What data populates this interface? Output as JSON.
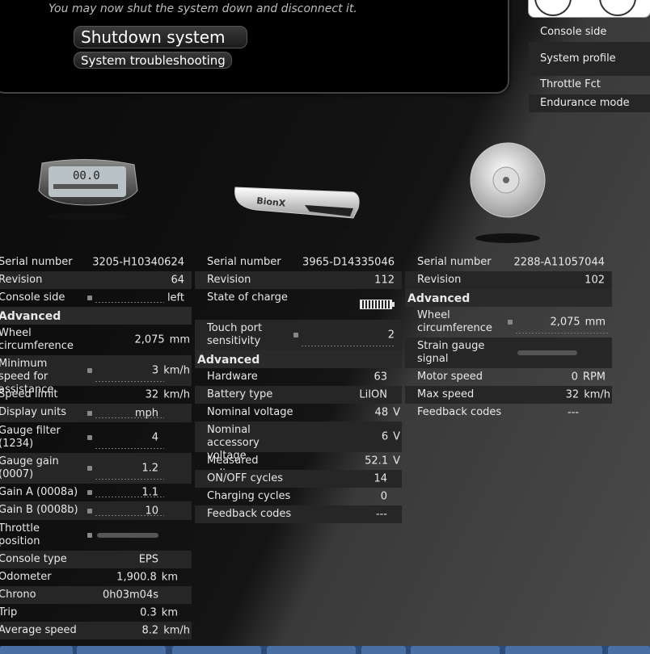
{
  "dialog": {
    "message": "You may now shut the system down and disconnect it.",
    "shutdown_label": "Shutdown system",
    "troubleshoot_label": "System troubleshooting"
  },
  "menu": {
    "items": [
      "Console side",
      "System profile",
      "Throttle Fct",
      "Endurance mode"
    ]
  },
  "console": {
    "rows": [
      {
        "label": "Serial number",
        "value": "3205-H10340624"
      },
      {
        "label": "Revision",
        "value": "64"
      },
      {
        "label": "Console side",
        "value": "left"
      },
      {
        "label": "Advanced",
        "value": ""
      },
      {
        "label": "Wheel circumference",
        "value": "2,075",
        "unit": "mm"
      },
      {
        "label": "Minimum speed for assistance",
        "value": "3",
        "unit": "km/h"
      },
      {
        "label": "Speed limit",
        "value": "32",
        "unit": "km/h"
      },
      {
        "label": "Display units",
        "value": "mph"
      },
      {
        "label": "Gauge filter (1234)",
        "value": "4"
      },
      {
        "label": "Gauge gain (0007)",
        "value": "1.2"
      },
      {
        "label": "Gain A (0008a)",
        "value": "1.1"
      },
      {
        "label": "Gain B (0008b)",
        "value": "10"
      },
      {
        "label": "Throttle position",
        "value": ""
      },
      {
        "label": "Console type",
        "value": "EPS"
      },
      {
        "label": "Odometer",
        "value": "1,900.8",
        "unit": "km"
      },
      {
        "label": "Chrono",
        "value": "0h03m04s"
      },
      {
        "label": "Trip",
        "value": "0.3",
        "unit": "km"
      },
      {
        "label": "Average speed",
        "value": "8.2",
        "unit": "km/h"
      }
    ]
  },
  "battery": {
    "rows": [
      {
        "label": "Serial number",
        "value": "3965-D14335046"
      },
      {
        "label": "Revision",
        "value": "112"
      },
      {
        "label": "State of charge",
        "value": ""
      },
      {
        "label": "Touch port sensitivity",
        "value": "2"
      },
      {
        "label": "Advanced",
        "value": ""
      },
      {
        "label": "Hardware",
        "value": "63"
      },
      {
        "label": "Battery type",
        "value": "LiION"
      },
      {
        "label": "Nominal voltage",
        "value": "48",
        "unit": "V"
      },
      {
        "label": "Nominal accessory voltage",
        "value": "6",
        "unit": "V"
      },
      {
        "label": "Measured voltage",
        "value": "52.1",
        "unit": "V"
      },
      {
        "label": "ON/OFF cycles",
        "value": "14"
      },
      {
        "label": "Charging cycles",
        "value": "0"
      },
      {
        "label": "Feedback codes",
        "value": "---"
      }
    ]
  },
  "motor": {
    "rows": [
      {
        "label": "Serial number",
        "value": "2288-A11057044"
      },
      {
        "label": "Revision",
        "value": "102"
      },
      {
        "label": "Advanced",
        "value": ""
      },
      {
        "label": "Wheel circumference",
        "value": "2,075",
        "unit": "mm"
      },
      {
        "label": "Strain gauge signal",
        "value": ""
      },
      {
        "label": "Motor speed",
        "value": "0",
        "unit": "RPM"
      },
      {
        "label": "Max speed",
        "value": "32",
        "unit": "km/h"
      },
      {
        "label": "Feedback codes",
        "value": "---"
      }
    ]
  },
  "devices": {
    "battery_logo": "BionX",
    "console_screen": "00.0"
  }
}
